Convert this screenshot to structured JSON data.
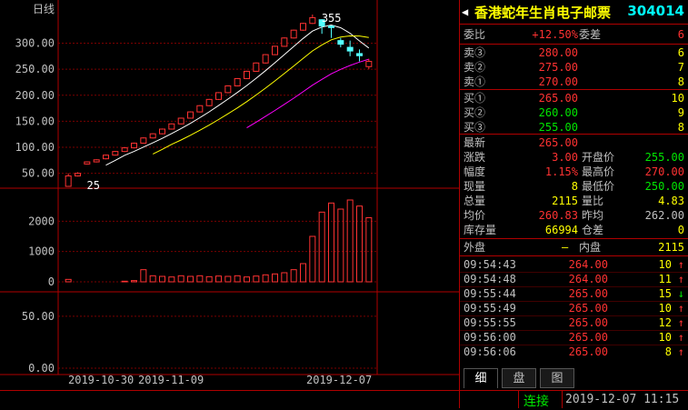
{
  "chart": {
    "period": "日线",
    "max_label": "355",
    "min_label": "25",
    "y_ticks_price": [
      "300.00",
      "250.00",
      "200.00",
      "150.00",
      "100.00",
      "50.00"
    ],
    "y_ticks_vol": [
      "2000",
      "1000",
      "0"
    ],
    "y_ticks_ind": [
      "50.00",
      "0.00"
    ],
    "x_dates": [
      "2019-10-30",
      "2019-11-09",
      "2019-12-07"
    ]
  },
  "chart_data": {
    "type": "candlestick",
    "ylim": [
      25,
      355
    ],
    "candles": [
      {
        "o": 25,
        "c": 45,
        "h": 50,
        "l": 25
      },
      {
        "o": 45,
        "c": 50,
        "h": 52,
        "l": 44
      },
      {
        "o": 68,
        "c": 72,
        "h": 73,
        "l": 67
      },
      {
        "o": 72,
        "c": 76,
        "h": 77,
        "l": 71
      },
      {
        "o": 78,
        "c": 85,
        "h": 86,
        "l": 77
      },
      {
        "o": 85,
        "c": 92,
        "h": 93,
        "l": 84
      },
      {
        "o": 92,
        "c": 99,
        "h": 100,
        "l": 91
      },
      {
        "o": 99,
        "c": 108,
        "h": 109,
        "l": 98
      },
      {
        "o": 108,
        "c": 118,
        "h": 119,
        "l": 107
      },
      {
        "o": 118,
        "c": 126,
        "h": 127,
        "l": 117
      },
      {
        "o": 126,
        "c": 135,
        "h": 136,
        "l": 125
      },
      {
        "o": 135,
        "c": 145,
        "h": 146,
        "l": 134
      },
      {
        "o": 145,
        "c": 156,
        "h": 157,
        "l": 144
      },
      {
        "o": 156,
        "c": 168,
        "h": 169,
        "l": 155
      },
      {
        "o": 168,
        "c": 180,
        "h": 181,
        "l": 167
      },
      {
        "o": 180,
        "c": 192,
        "h": 193,
        "l": 179
      },
      {
        "o": 192,
        "c": 205,
        "h": 206,
        "l": 191
      },
      {
        "o": 205,
        "c": 218,
        "h": 219,
        "l": 204
      },
      {
        "o": 218,
        "c": 232,
        "h": 233,
        "l": 217
      },
      {
        "o": 232,
        "c": 246,
        "h": 247,
        "l": 231
      },
      {
        "o": 246,
        "c": 262,
        "h": 263,
        "l": 245
      },
      {
        "o": 262,
        "c": 278,
        "h": 279,
        "l": 261
      },
      {
        "o": 278,
        "c": 294,
        "h": 295,
        "l": 277
      },
      {
        "o": 294,
        "c": 310,
        "h": 311,
        "l": 293
      },
      {
        "o": 310,
        "c": 325,
        "h": 326,
        "l": 309
      },
      {
        "o": 325,
        "c": 338,
        "h": 339,
        "l": 324
      },
      {
        "o": 338,
        "c": 349,
        "h": 355,
        "l": 337
      },
      {
        "o": 345,
        "c": 333,
        "h": 346,
        "l": 318
      },
      {
        "o": 333,
        "c": 330,
        "h": 334,
        "l": 310
      },
      {
        "o": 305,
        "c": 298,
        "h": 310,
        "l": 292
      },
      {
        "o": 292,
        "c": 285,
        "h": 305,
        "l": 275
      },
      {
        "o": 280,
        "c": 276,
        "h": 288,
        "l": 265
      },
      {
        "o": 255,
        "c": 265,
        "h": 270,
        "l": 250
      }
    ],
    "volume": [
      80,
      0,
      0,
      0,
      0,
      0,
      20,
      40,
      400,
      200,
      180,
      160,
      200,
      180,
      200,
      170,
      190,
      180,
      200,
      160,
      190,
      230,
      260,
      300,
      400,
      600,
      1500,
      2300,
      2600,
      2400,
      2700,
      2500,
      2115
    ]
  },
  "panel": {
    "name": "香港蛇年生肖电子邮票",
    "code": "304014",
    "arrow_l": "◀",
    "arrow_r": "▶",
    "wb_label": "委比",
    "wb_val": "+12.50%",
    "wc_label": "委差",
    "wc_val": "6",
    "asks": [
      {
        "label": "卖③",
        "price": "280.00",
        "qty": "6"
      },
      {
        "label": "卖②",
        "price": "275.00",
        "qty": "7"
      },
      {
        "label": "卖①",
        "price": "270.00",
        "qty": "8"
      }
    ],
    "bids": [
      {
        "label": "买①",
        "price": "265.00",
        "qty": "10"
      },
      {
        "label": "买②",
        "price": "260.00",
        "qty": "9"
      },
      {
        "label": "买③",
        "price": "255.00",
        "qty": "8"
      }
    ],
    "quote": {
      "latest_l": "最新",
      "latest": "265.00",
      "chg_l": "涨跌",
      "chg": "3.00",
      "open_l": "开盘价",
      "open": "255.00",
      "pct_l": "幅度",
      "pct": "1.15%",
      "high_l": "最高价",
      "high": "270.00",
      "cur_l": "现量",
      "cur": "8",
      "low_l": "最低价",
      "low": "250.00",
      "vol_l": "总量",
      "vol": "2115",
      "lb_l": "量比",
      "lb": "4.83",
      "avg_l": "均价",
      "avg": "260.83",
      "prev_l": "昨均",
      "prev": "262.00",
      "stock_l": "库存量",
      "stock": "66994",
      "cang_l": "仓差",
      "cang": "0"
    },
    "out_l": "外盘",
    "dash": "—",
    "in_l": "内盘",
    "in_val": "2115",
    "ticks": [
      {
        "t": "09:54:43",
        "p": "264.00",
        "q": "10",
        "d": "↑"
      },
      {
        "t": "09:54:48",
        "p": "264.00",
        "q": "11",
        "d": "↑"
      },
      {
        "t": "09:55:44",
        "p": "265.00",
        "q": "15",
        "d": "↓"
      },
      {
        "t": "09:55:49",
        "p": "265.00",
        "q": "10",
        "d": "↑"
      },
      {
        "t": "09:55:55",
        "p": "265.00",
        "q": "12",
        "d": "↑"
      },
      {
        "t": "09:56:00",
        "p": "265.00",
        "q": "10",
        "d": "↑"
      },
      {
        "t": "09:56:06",
        "p": "265.00",
        "q": "8",
        "d": "↑"
      }
    ],
    "tabs": [
      "细",
      "盘",
      "图"
    ]
  },
  "status": {
    "conn": "连接",
    "time": "2019-12-07 11:15"
  }
}
